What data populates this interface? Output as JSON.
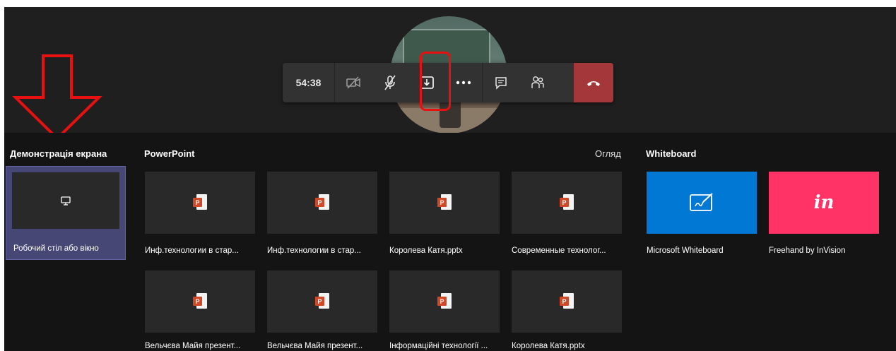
{
  "toolbar": {
    "timer": "54:38",
    "buttons": [
      {
        "name": "camera-off",
        "icon": "camera-off-icon"
      },
      {
        "name": "mic-off",
        "icon": "mic-off-icon"
      },
      {
        "name": "share",
        "icon": "share-tray-icon"
      },
      {
        "name": "more",
        "icon": "more-icon"
      },
      {
        "name": "chat",
        "icon": "chat-icon"
      },
      {
        "name": "participants",
        "icon": "participants-icon"
      },
      {
        "name": "hang-up",
        "icon": "hang-up-icon"
      }
    ],
    "hangup_color": "#a4373a"
  },
  "annotations": {
    "highlight_color": "#e81010"
  },
  "sections": {
    "desktop": {
      "title": "Демонстрація екрана",
      "item_label": "Робочий стіл або вікно"
    },
    "powerpoint": {
      "title": "PowerPoint",
      "browse": "Огляд",
      "files": [
        "Инф.технологии в стар...",
        "Инф.технологии в стар...",
        "Королева Катя.pptx",
        "Современные технолог...",
        "Вельчєва Майя презент...",
        "Вельчєва Майя презент...",
        "Інформаційні технології ...",
        "Королева Катя.pptx"
      ]
    },
    "whiteboard": {
      "title": "Whiteboard",
      "apps": [
        {
          "label": "Microsoft Whiteboard",
          "color": "#0078d4"
        },
        {
          "label": "Freehand by InVision",
          "color": "#ff3366",
          "logo": "in"
        }
      ]
    }
  }
}
